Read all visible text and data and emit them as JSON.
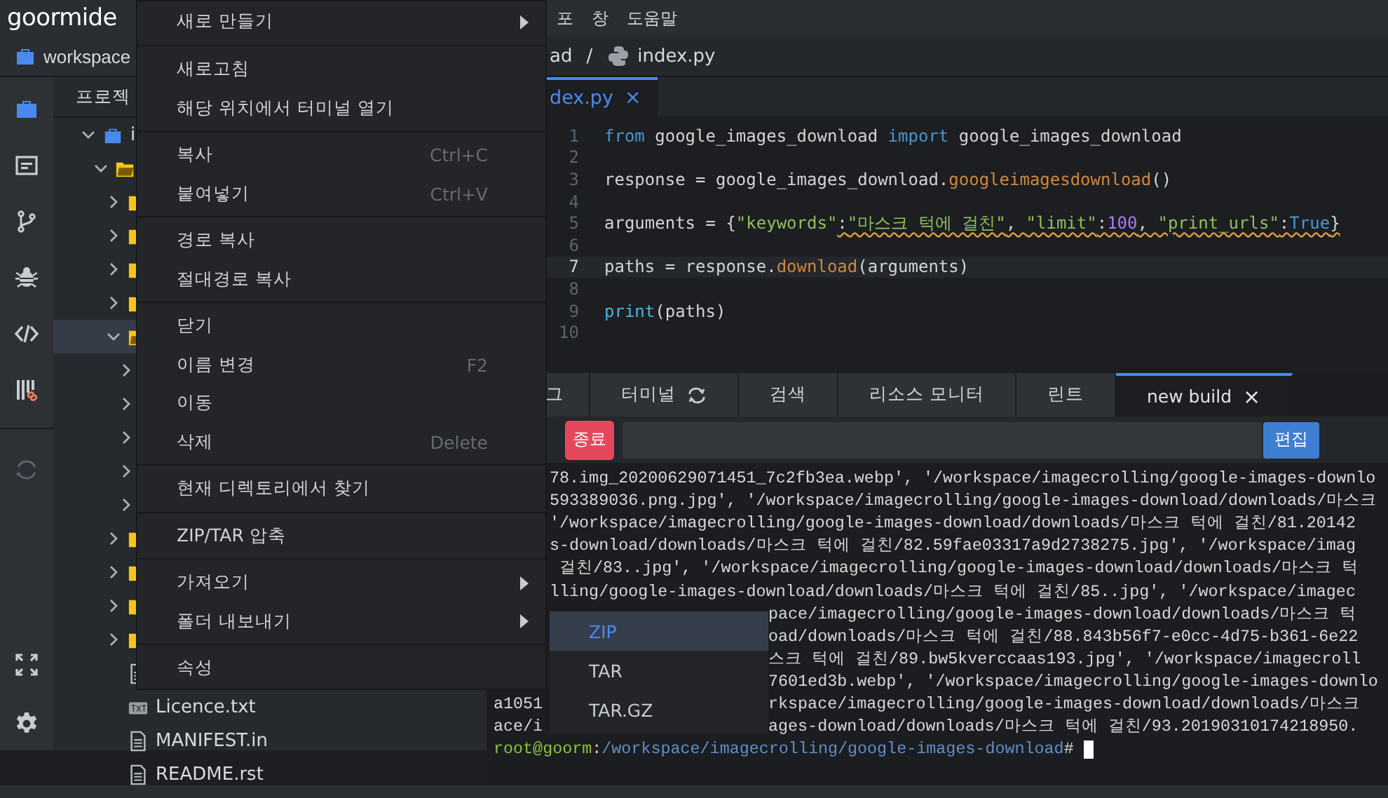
{
  "topbar": {
    "logo": "goormide",
    "menus": [
      "포",
      "창",
      "도움말"
    ]
  },
  "workspace_tab": {
    "label": "workspace"
  },
  "breadcrumb": {
    "folder": "ad",
    "separator": "/",
    "file": "index.py"
  },
  "activity_bar": {
    "top": [
      {
        "kind": "briefcase"
      },
      {
        "kind": "window"
      },
      {
        "kind": "branch"
      },
      {
        "kind": "bug"
      },
      {
        "kind": "code"
      },
      {
        "kind": "library"
      }
    ],
    "middle": [
      {
        "kind": "spinner"
      }
    ],
    "bottom": [
      {
        "kind": "expand"
      },
      {
        "kind": "gear"
      }
    ]
  },
  "tree": {
    "header": "프로젝",
    "items": [
      {
        "kind": "project",
        "label": "i",
        "expanded": true,
        "selected": false,
        "children": [
          {
            "kind": "folder",
            "expanded": true,
            "selected": false,
            "children": [
              {
                "kind": "folder",
                "expanded": false,
                "selected": false
              },
              {
                "kind": "folder",
                "expanded": false,
                "selected": false
              },
              {
                "kind": "folder",
                "expanded": false,
                "selected": false
              },
              {
                "kind": "folder",
                "expanded": false,
                "selected": false
              },
              {
                "kind": "folder",
                "expanded": true,
                "selected": true,
                "children": [
                  {
                    "expanded": false,
                    "selected": false
                  },
                  {
                    "expanded": false,
                    "selected": false
                  },
                  {
                    "expanded": false,
                    "selected": false
                  },
                  {
                    "expanded": false,
                    "selected": false
                  },
                  {
                    "expanded": false,
                    "selected": false
                  }
                ]
              },
              {
                "kind": "folder",
                "expanded": false,
                "selected": false
              },
              {
                "kind": "folder",
                "expanded": false,
                "selected": false
              },
              {
                "kind": "folder",
                "expanded": false,
                "selected": false
              },
              {
                "kind": "folder",
                "expanded": false,
                "selected": false
              },
              {
                "kind": "file",
                "selected": false
              },
              {
                "kind": "text-file",
                "label": "Licence.txt",
                "selected": false
              },
              {
                "kind": "file",
                "label": "MANIFEST.in",
                "selected": false
              },
              {
                "kind": "file",
                "label": "README.rst",
                "selected": false
              }
            ]
          }
        ]
      }
    ]
  },
  "editor": {
    "tabs": [
      {
        "label": "dex.py",
        "close": "×",
        "selected": true
      }
    ],
    "lines": [
      {
        "n": "1",
        "active": false,
        "tokens": [
          {
            "kind": "kw",
            "t": "from"
          },
          {
            "kind": "plain",
            "t": " google_images_download "
          },
          {
            "kind": "kw",
            "t": "import"
          },
          {
            "kind": "plain",
            "t": " google_images_download"
          }
        ]
      },
      {
        "n": "2",
        "active": false
      },
      {
        "n": "3",
        "active": false,
        "tokens": [
          {
            "kind": "plain",
            "t": "response = google_images_download."
          },
          {
            "kind": "fn",
            "t": "googleimagesdownload"
          },
          {
            "kind": "plain",
            "t": "()"
          }
        ]
      },
      {
        "n": "4",
        "active": false
      },
      {
        "n": "5",
        "active": false,
        "tokens": [
          {
            "kind": "plain",
            "t": "arguments = {"
          },
          {
            "kind": "str",
            "t": "\"keywords\""
          }
        ],
        "warning_tokens": [
          {
            "kind": "plain",
            "t": ":"
          },
          {
            "kind": "str",
            "t": "\"마스크 턱에 걸친\""
          },
          {
            "kind": "plain",
            "t": ", "
          },
          {
            "kind": "str",
            "t": "\"limit\""
          },
          {
            "kind": "plain",
            "t": ":"
          },
          {
            "kind": "num",
            "t": "100"
          },
          {
            "kind": "plain",
            "t": ", "
          },
          {
            "kind": "str",
            "t": "\"print_urls\""
          },
          {
            "kind": "plain",
            "t": ":"
          },
          {
            "kind": "const",
            "t": "True"
          },
          {
            "kind": "plain",
            "t": "}"
          }
        ]
      },
      {
        "n": "6",
        "active": false
      },
      {
        "n": "7",
        "active": true,
        "tokens": [
          {
            "kind": "plain",
            "t": "paths = response."
          },
          {
            "kind": "fn",
            "t": "download"
          },
          {
            "kind": "plain",
            "t": "(arguments)"
          }
        ]
      },
      {
        "n": "8",
        "active": false
      },
      {
        "n": "9",
        "active": false,
        "tokens": [
          {
            "kind": "builtin",
            "t": "print"
          },
          {
            "kind": "plain",
            "t": "(paths)"
          }
        ]
      },
      {
        "n": "10",
        "active": false
      }
    ]
  },
  "bottom_panel": {
    "tabs": [
      {
        "kind": "plain",
        "label": "그",
        "selected": false
      },
      {
        "kind": "refresh",
        "label": "터미널",
        "selected": false
      },
      {
        "kind": "plain",
        "label": "검색",
        "selected": false
      },
      {
        "kind": "plain",
        "label": "리소스 모니터",
        "selected": false
      },
      {
        "kind": "plain",
        "label": "린트",
        "selected": false
      },
      {
        "kind": "closable",
        "label": "new build",
        "close": "×",
        "selected": true
      }
    ],
    "stop_button": "종료",
    "edit_button": "편집",
    "terminal": [
      {
        "kind": "behind-menu",
        "text": "78.img_20200629071451_7c2fb3ea.webp', '/workspace/imagecrolling/google-images-downlo"
      },
      {
        "kind": "behind-menu",
        "text": "593389036.png.jpg', '/workspace/imagecrolling/google-images-download/downloads/마스크"
      },
      {
        "kind": "behind-menu",
        "text": "'/workspace/imagecrolling/google-images-download/downloads/마스크 턱에 걸친/81.20142"
      },
      {
        "kind": "behind-menu",
        "text": "s-download/downloads/마스크 턱에 걸친/82.59fae03317a9d2738275.jpg', '/workspace/imag"
      },
      {
        "kind": "behind-menu",
        "text": " 걸친/83..jpg', '/workspace/imagecrolling/google-images-download/downloads/마스크 턱"
      },
      {
        "kind": "behind-menu",
        "text": "lling/google-images-download/downloads/마스크 턱에 걸친/85..jpg', '/workspace/imagec"
      },
      {
        "kind": "behind-submenu",
        "text": "pace/imagecrolling/google-images-download/downloads/마스크 턱"
      },
      {
        "kind": "behind-submenu",
        "text": "oad/downloads/마스크 턱에 걸친/88.843b56f7-e0cc-4d75-b361-6e22"
      },
      {
        "kind": "behind-submenu",
        "text": "스크 턱에 걸친/89.bw5kverccaas193.jpg', '/workspace/imagecroll"
      },
      {
        "kind": "behind-submenu",
        "text": "7601ed3b.webp', '/workspace/imagecrolling/google-images-downlo"
      },
      {
        "kind": "behind-submenu",
        "left": "a1051",
        "text": "rkspace/imagecrolling/google-images-download/downloads/마스크"
      },
      {
        "kind": "behind-submenu",
        "left": "ace/i",
        "text": "ages-download/downloads/마스크 턱에 걸친/93.20190310174218950."
      },
      {
        "kind": "prompt",
        "user": "root@goorm",
        "sep": ":",
        "path": "/workspace/imagecrolling/google-images-download",
        "end": "#"
      }
    ]
  },
  "context_menu": {
    "groups": [
      [
        {
          "label": "새로 만들기",
          "submenu": true
        }
      ],
      [
        {
          "label": "새로고침"
        },
        {
          "label": "해당 위치에서 터미널 열기"
        }
      ],
      [
        {
          "label": "복사",
          "shortcut": "Ctrl+C"
        },
        {
          "label": "붙여넣기",
          "shortcut": "Ctrl+V"
        }
      ],
      [
        {
          "label": "경로 복사"
        },
        {
          "label": "절대경로 복사"
        }
      ],
      [
        {
          "label": "닫기"
        },
        {
          "label": "이름 변경",
          "shortcut": "F2"
        },
        {
          "label": "이동"
        },
        {
          "label": "삭제",
          "shortcut": "Delete"
        }
      ],
      [
        {
          "label": "현재 디렉토리에서 찾기"
        }
      ],
      [
        {
          "label": "ZIP/TAR 압축"
        }
      ],
      [
        {
          "label": "가져오기",
          "submenu": true
        },
        {
          "label": "폴더 내보내기",
          "submenu": true
        }
      ],
      [
        {
          "label": "속성"
        }
      ]
    ]
  },
  "submenu": {
    "items": [
      {
        "label": "ZIP",
        "selected": true
      },
      {
        "label": "TAR",
        "selected": false
      },
      {
        "label": "TAR.GZ",
        "selected": false
      }
    ]
  }
}
